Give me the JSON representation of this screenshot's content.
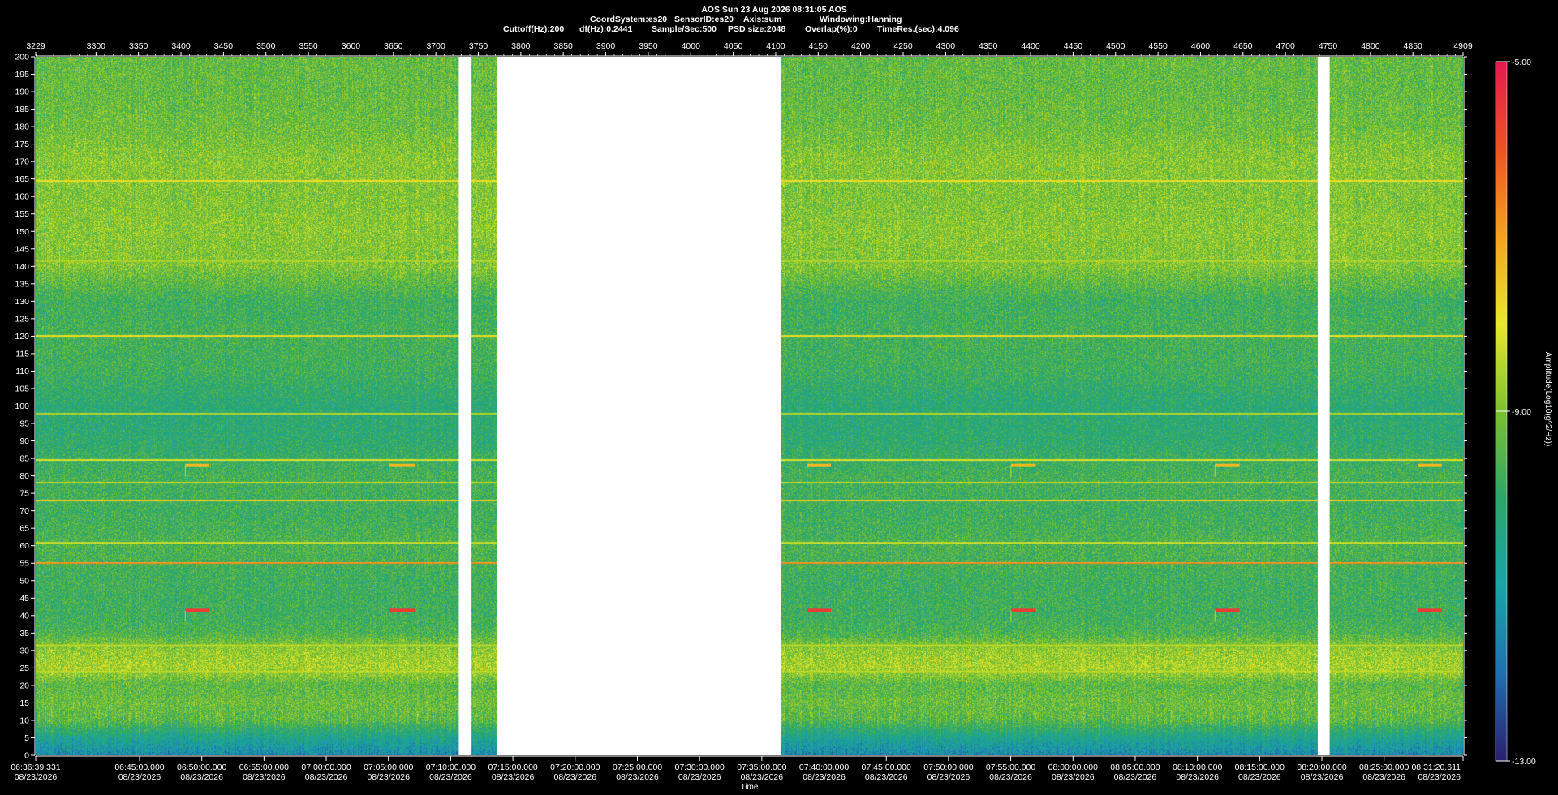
{
  "header": {
    "title": "AOS  Sun 23 Aug 2026 08:31:05  AOS",
    "params_line1": [
      "CoordSystem:es20",
      "SensorID:es20",
      "Axis:sum",
      "Windowing:Hanning"
    ],
    "params_line2": [
      "Cuttoff(Hz):200",
      "df(Hz):0.2441",
      "Sample/Sec:500",
      "PSD size:2048",
      "Overlap(%):0",
      "TimeRes.(sec):4.096"
    ]
  },
  "chart_data": {
    "type": "heatmap",
    "title": "AOS  Sun 23 Aug 2026 08:31:05  AOS",
    "xlabel": "Time",
    "ylabel": "",
    "ylim": [
      0,
      200
    ],
    "yticks": [
      0,
      5,
      10,
      15,
      20,
      25,
      30,
      35,
      40,
      45,
      50,
      55,
      60,
      65,
      70,
      75,
      80,
      85,
      90,
      95,
      100,
      105,
      110,
      115,
      120,
      125,
      130,
      135,
      140,
      145,
      150,
      155,
      160,
      165,
      170,
      175,
      180,
      185,
      190,
      195,
      200
    ],
    "top_axis": {
      "range": [
        3229,
        4909
      ],
      "ticks": [
        3229,
        3300,
        3350,
        3400,
        3450,
        3500,
        3550,
        3600,
        3650,
        3700,
        3750,
        3800,
        3850,
        3900,
        3950,
        4000,
        4050,
        4100,
        4150,
        4200,
        4250,
        4300,
        4350,
        4400,
        4450,
        4500,
        4550,
        4600,
        4650,
        4700,
        4750,
        4800,
        4850,
        4909
      ]
    },
    "time_axis": {
      "start": "06:36:39.331",
      "end": "08:31:20.611",
      "ticks": [
        {
          "time": "06:36:39.331",
          "date": "08/23/2026"
        },
        {
          "time": "06:45:00.000",
          "date": "08/23/2026"
        },
        {
          "time": "06:50:00.000",
          "date": "08/23/2026"
        },
        {
          "time": "06:55:00.000",
          "date": "08/23/2026"
        },
        {
          "time": "07:00:00.000",
          "date": "08/23/2026"
        },
        {
          "time": "07:05:00.000",
          "date": "08/23/2026"
        },
        {
          "time": "07:10:00.000",
          "date": "08/23/2026"
        },
        {
          "time": "07:15:00.000",
          "date": "08/23/2026"
        },
        {
          "time": "07:20:00.000",
          "date": "08/23/2026"
        },
        {
          "time": "07:25:00.000",
          "date": "08/23/2026"
        },
        {
          "time": "07:30:00.000",
          "date": "08/23/2026"
        },
        {
          "time": "07:35:00.000",
          "date": "08/23/2026"
        },
        {
          "time": "07:40:00.000",
          "date": "08/23/2026"
        },
        {
          "time": "07:45:00.000",
          "date": "08/23/2026"
        },
        {
          "time": "07:50:00.000",
          "date": "08/23/2026"
        },
        {
          "time": "07:55:00.000",
          "date": "08/23/2026"
        },
        {
          "time": "08:00:00.000",
          "date": "08/23/2026"
        },
        {
          "time": "08:05:00.000",
          "date": "08/23/2026"
        },
        {
          "time": "08:10:00.000",
          "date": "08/23/2026"
        },
        {
          "time": "08:15:00.000",
          "date": "08/23/2026"
        },
        {
          "time": "08:20:00.000",
          "date": "08/23/2026"
        },
        {
          "time": "08:25:00.000",
          "date": "08/23/2026"
        },
        {
          "time": "08:31:20.611",
          "date": "08/23/2026"
        }
      ]
    },
    "data_gaps_top_axis": [
      [
        3727,
        3742
      ],
      [
        3772,
        4106
      ],
      [
        4738,
        4752
      ]
    ],
    "colorbar": {
      "label": "Amplitude(Log10(g^2/Hz))",
      "min": -13.0,
      "max": -5.0,
      "tick_labels": [
        "-5.00",
        "-9.00",
        "-13.00"
      ],
      "colors": [
        "#2a1f6e",
        "#1f6fb0",
        "#19a5a8",
        "#2aa56a",
        "#7cc12e",
        "#e8e82a",
        "#f5a21f",
        "#ee5222",
        "#e6194f"
      ]
    },
    "background_profile": {
      "note_levels_freq_hz": [
        0,
        5,
        10,
        15,
        20,
        25,
        30,
        35,
        40,
        50,
        60,
        70,
        80,
        90,
        100,
        110,
        120,
        130,
        140,
        150,
        160,
        170,
        180,
        190,
        200
      ],
      "levels_log10": [
        -11.5,
        -10.6,
        -9.4,
        -9.2,
        -9.4,
        -8.6,
        -8.8,
        -9.6,
        -9.8,
        -9.8,
        -9.6,
        -9.8,
        -9.7,
        -10.1,
        -10.2,
        -9.8,
        -9.7,
        -9.8,
        -9.0,
        -8.9,
        -9.0,
        -8.9,
        -9.2,
        -9.3,
        -9.3
      ]
    },
    "tonal_lines": [
      {
        "freq_hz": 120,
        "level": -7.6
      },
      {
        "freq_hz": 141.5,
        "level": -8.3
      },
      {
        "freq_hz": 164.5,
        "level": -7.6
      },
      {
        "freq_hz": 97.8,
        "level": -8.2
      },
      {
        "freq_hz": 84.5,
        "level": -7.8
      },
      {
        "freq_hz": 78,
        "level": -8.0
      },
      {
        "freq_hz": 73,
        "level": -7.4
      },
      {
        "freq_hz": 60.8,
        "level": -8.0
      },
      {
        "freq_hz": 55,
        "level": -6.5
      },
      {
        "freq_hz": 31.5,
        "level": -8.3
      },
      {
        "freq_hz": 24,
        "level": -8.3
      }
    ],
    "intermittent_events": [
      {
        "top_axis_start": 3405,
        "top_axis_end": 3433,
        "freq_hz": 41.5,
        "level": -5.6
      },
      {
        "top_axis_start": 3405,
        "top_axis_end": 3433,
        "freq_hz": 83,
        "level": -7.3
      },
      {
        "top_axis_start": 3645,
        "top_axis_end": 3675,
        "freq_hz": 41.5,
        "level": -5.6
      },
      {
        "top_axis_start": 3645,
        "top_axis_end": 3675,
        "freq_hz": 83,
        "level": -7.3
      },
      {
        "top_axis_start": 4137,
        "top_axis_end": 4165,
        "freq_hz": 41.5,
        "level": -5.6
      },
      {
        "top_axis_start": 4137,
        "top_axis_end": 4165,
        "freq_hz": 83,
        "level": -7.3
      },
      {
        "top_axis_start": 4377,
        "top_axis_end": 4406,
        "freq_hz": 41.5,
        "level": -5.6
      },
      {
        "top_axis_start": 4377,
        "top_axis_end": 4406,
        "freq_hz": 83,
        "level": -7.3
      },
      {
        "top_axis_start": 4617,
        "top_axis_end": 4646,
        "freq_hz": 41.5,
        "level": -5.6
      },
      {
        "top_axis_start": 4617,
        "top_axis_end": 4646,
        "freq_hz": 83,
        "level": -7.3
      },
      {
        "top_axis_start": 4856,
        "top_axis_end": 4884,
        "freq_hz": 41.5,
        "level": -5.6
      },
      {
        "top_axis_start": 4856,
        "top_axis_end": 4884,
        "freq_hz": 83,
        "level": -7.3
      }
    ]
  }
}
